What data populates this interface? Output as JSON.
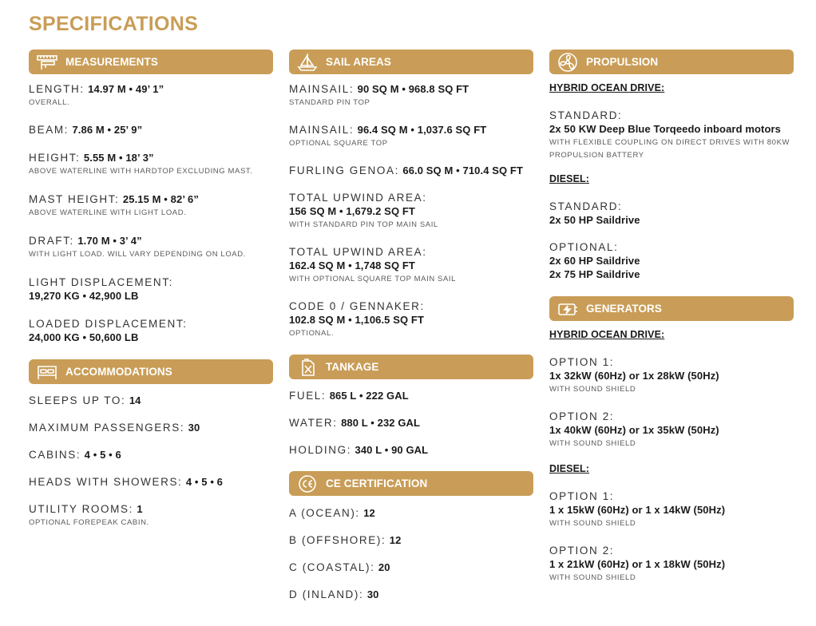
{
  "title": "SPECIFICATIONS",
  "colors": {
    "accent": "#c99d57",
    "header_text": "#ffffff"
  },
  "measurements": {
    "heading": "MEASUREMENTS",
    "icon": "ruler-caliper-icon",
    "length": {
      "label": "LENGTH:",
      "value": "14.97 M • 49’ 1”",
      "note": "OVERALL."
    },
    "beam": {
      "label": "BEAM:",
      "value": "7.86 M • 25’ 9”"
    },
    "height": {
      "label": "HEIGHT:",
      "value": "5.55 M • 18’ 3”",
      "note": "ABOVE WATERLINE WITH HARDTOP EXCLUDING MAST."
    },
    "mast_height": {
      "label": "MAST HEIGHT:",
      "value": "25.15 M • 82’ 6”",
      "note": "ABOVE WATERLINE WITH LIGHT LOAD."
    },
    "draft": {
      "label": "DRAFT:",
      "value": "1.70 M • 3’ 4”",
      "note": "WITH LIGHT LOAD. WILL VARY DEPENDING ON LOAD."
    },
    "light_displacement": {
      "label": "LIGHT DISPLACEMENT:",
      "value": "19,270 KG • 42,900 LB"
    },
    "loaded_displacement": {
      "label": "LOADED DISPLACEMENT:",
      "value": "24,000 KG • 50,600 LB"
    }
  },
  "accommodations": {
    "heading": "ACCOMMODATIONS",
    "icon": "bed-icon",
    "sleeps": {
      "label": "SLEEPS UP TO:",
      "value": "14"
    },
    "passengers": {
      "label": "MAXIMUM PASSENGERS:",
      "value": "30"
    },
    "cabins": {
      "label": "CABINS:",
      "value": "4 • 5 • 6"
    },
    "heads": {
      "label": "HEADS WITH SHOWERS:",
      "value": "4 • 5 • 6"
    },
    "utility": {
      "label": "UTILITY ROOMS:",
      "value": "1",
      "note": "OPTIONAL FOREPEAK CABIN."
    }
  },
  "sail_areas": {
    "heading": "SAIL AREAS",
    "icon": "sailboat-icon",
    "mainsail_std": {
      "label": "MAINSAIL:",
      "value": "90 SQ M • 968.8 SQ FT",
      "note": "STANDARD PIN TOP"
    },
    "mainsail_opt": {
      "label": "MAINSAIL:",
      "value": "96.4 SQ M • 1,037.6 SQ FT",
      "note": "OPTIONAL SQUARE TOP"
    },
    "genoa": {
      "label": "FURLING GENOA:",
      "value": "66.0 SQ M • 710.4 SQ FT"
    },
    "upwind_std": {
      "label": "TOTAL UPWIND AREA:",
      "value": "156 SQ M • 1,679.2 SQ FT",
      "note": "WITH STANDARD PIN TOP MAIN SAIL"
    },
    "upwind_opt": {
      "label": "TOTAL UPWIND AREA:",
      "value": "162.4 SQ M • 1,748 SQ FT",
      "note": "WITH OPTIONAL SQUARE TOP MAIN SAIL"
    },
    "code0": {
      "label": "CODE 0 / GENNAKER:",
      "value": "102.8 SQ M • 1,106.5 SQ FT",
      "note": "OPTIONAL."
    }
  },
  "tankage": {
    "heading": "TANKAGE",
    "icon": "jerrycan-icon",
    "fuel": {
      "label": "FUEL:",
      "value": "865 L • 222 GAL"
    },
    "water": {
      "label": "WATER:",
      "value": "880 L • 232 GAL"
    },
    "holding": {
      "label": "HOLDING:",
      "value": "340 L • 90 GAL"
    }
  },
  "ce": {
    "heading": "CE CERTIFICATION",
    "icon": "ce-mark-icon",
    "a": {
      "label": "A (OCEAN):",
      "value": "12"
    },
    "b": {
      "label": "B (OFFSHORE):",
      "value": "12"
    },
    "c": {
      "label": "C (COASTAL):",
      "value": "20"
    },
    "d": {
      "label": "D (INLAND):",
      "value": "30"
    }
  },
  "propulsion": {
    "heading": "PROPULSION",
    "icon": "propeller-icon",
    "hybrid_title": "HYBRID OCEAN DRIVE:",
    "hybrid_standard": {
      "label": "STANDARD:",
      "value": "2x 50 KW Deep Blue Torqeedo inboard motors",
      "note": "WITH FLEXIBLE COUPLING ON DIRECT DRIVES WITH 80KW PROPULSION BATTERY"
    },
    "diesel_title": "DIESEL:",
    "diesel_standard": {
      "label": "STANDARD:",
      "value": "2x 50 HP Saildrive"
    },
    "diesel_optional": {
      "label": "OPTIONAL:",
      "value1": "2x 60 HP Saildrive",
      "value2": "2x 75 HP Saildrive"
    }
  },
  "generators": {
    "heading": "GENERATORS",
    "icon": "battery-charge-icon",
    "hybrid_title": "HYBRID OCEAN DRIVE:",
    "hybrid_opt1": {
      "label": "OPTION 1:",
      "value": "1x 32kW (60Hz) or 1x 28kW (50Hz)",
      "note": "WITH SOUND SHIELD"
    },
    "hybrid_opt2": {
      "label": "OPTION 2:",
      "value": "1x 40kW (60Hz) or 1x 35kW (50Hz)",
      "note": "WITH SOUND SHIELD"
    },
    "diesel_title": "DIESEL:",
    "diesel_opt1": {
      "label": "OPTION 1:",
      "value": "1 x 15kW (60Hz) or 1 x 14kW (50Hz)",
      "note": "WITH SOUND SHIELD"
    },
    "diesel_opt2": {
      "label": "OPTION 2:",
      "value": "1 x 21kW (60Hz) or 1 x 18kW (50Hz)",
      "note": "WITH SOUND SHIELD"
    }
  }
}
